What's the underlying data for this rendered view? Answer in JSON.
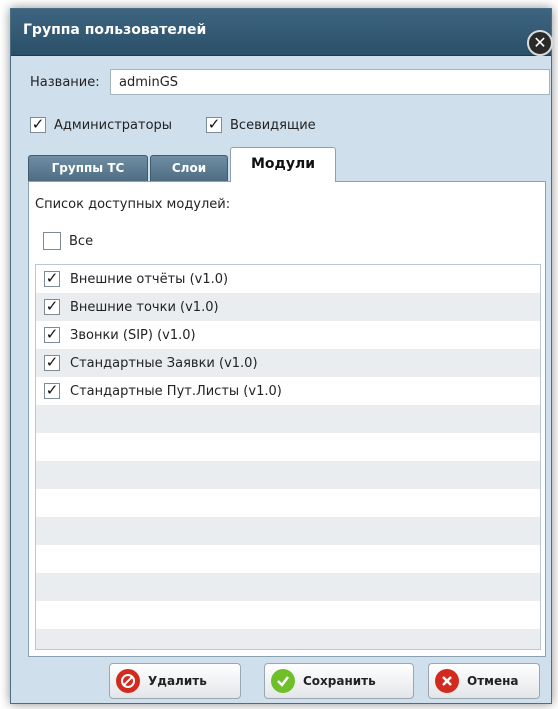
{
  "dialog": {
    "title": "Группа пользователей",
    "close_symbol": "✕",
    "name_label": "Название:",
    "name_value": "adminGS",
    "checkboxes": [
      {
        "label": "Администраторы",
        "checked": true
      },
      {
        "label": "Всевидящие",
        "checked": true
      }
    ],
    "tabs": [
      {
        "label": "Группы ТС",
        "active": false
      },
      {
        "label": "Слои",
        "active": false
      },
      {
        "label": "Модули",
        "active": true
      }
    ],
    "list_caption": "Список доступных модулей:",
    "all_label": "Все",
    "all_checked": false,
    "modules": [
      {
        "label": "Внешние отчёты (v1.0)",
        "checked": true
      },
      {
        "label": "Внешние точки (v1.0)",
        "checked": true
      },
      {
        "label": "Звонки (SIP) (v1.0)",
        "checked": true
      },
      {
        "label": "Стандартные Заявки (v1.0)",
        "checked": true
      },
      {
        "label": "Стандартные Пут.Листы (v1.0)",
        "checked": true
      }
    ],
    "check_mark": "✓",
    "buttons": {
      "delete": {
        "label": "Удалить",
        "icon": "forbidden-icon",
        "color": "#d22a1e"
      },
      "save": {
        "label": "Сохранить",
        "icon": "checkmark-icon",
        "color": "#6fbf2a"
      },
      "cancel": {
        "label": "Отмена",
        "icon": "close-icon",
        "color": "#d22a1e"
      }
    }
  }
}
